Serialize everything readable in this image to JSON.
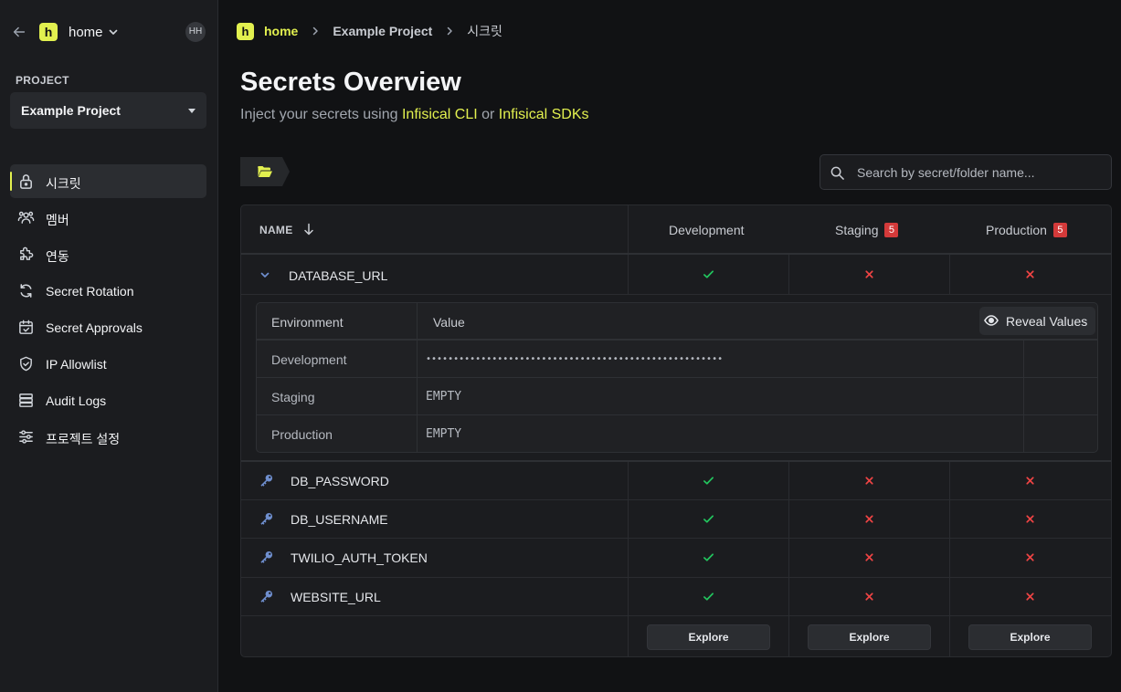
{
  "sidebar": {
    "org_logo_letter": "h",
    "org_name": "home",
    "avatar_initials": "HH",
    "project_label": "PROJECT",
    "project_selected": "Example Project",
    "nav": [
      {
        "label": "시크릿",
        "icon": "lock-icon",
        "active": true
      },
      {
        "label": "멤버",
        "icon": "users-icon",
        "active": false
      },
      {
        "label": "연동",
        "icon": "puzzle-icon",
        "active": false
      },
      {
        "label": "Secret Rotation",
        "icon": "rotate-icon",
        "active": false
      },
      {
        "label": "Secret Approvals",
        "icon": "approval-icon",
        "active": false
      },
      {
        "label": "IP Allowlist",
        "icon": "shield-icon",
        "active": false
      },
      {
        "label": "Audit Logs",
        "icon": "logs-icon",
        "active": false
      },
      {
        "label": "프로젝트 설정",
        "icon": "sliders-icon",
        "active": false
      }
    ]
  },
  "breadcrumb": {
    "logo_letter": "h",
    "home": "home",
    "sep": ">",
    "project": "Example Project",
    "current": "시크릿"
  },
  "header": {
    "title": "Secrets Overview",
    "subtitle_pre": "Inject your secrets using ",
    "link_cli": "Infisical CLI",
    "subtitle_mid": " or ",
    "link_sdks": "Infisical SDKs"
  },
  "search": {
    "placeholder": "Search by secret/folder name..."
  },
  "table": {
    "name_header": "NAME",
    "environments": [
      {
        "name": "Development",
        "badge": ""
      },
      {
        "name": "Staging",
        "badge": "5"
      },
      {
        "name": "Production",
        "badge": "5"
      }
    ],
    "rows": [
      {
        "name": "DATABASE_URL",
        "expanded": true,
        "status": [
          "present",
          "missing",
          "missing"
        ]
      },
      {
        "name": "DB_PASSWORD",
        "expanded": false,
        "status": [
          "present",
          "missing",
          "missing"
        ]
      },
      {
        "name": "DB_USERNAME",
        "expanded": false,
        "status": [
          "present",
          "missing",
          "missing"
        ]
      },
      {
        "name": "TWILIO_AUTH_TOKEN",
        "expanded": false,
        "status": [
          "present",
          "missing",
          "missing"
        ]
      },
      {
        "name": "WEBSITE_URL",
        "expanded": false,
        "status": [
          "present",
          "missing",
          "missing"
        ]
      }
    ],
    "expanded_detail": {
      "col_env": "Environment",
      "col_value": "Value",
      "reveal_label": "Reveal Values",
      "rows": [
        {
          "env": "Development",
          "value": "••••••••••••••••••••••••••••••••••••••••••••••••••••••"
        },
        {
          "env": "Staging",
          "value": "EMPTY"
        },
        {
          "env": "Production",
          "value": "EMPTY"
        }
      ]
    },
    "explore_label": "Explore"
  },
  "colors": {
    "accent": "#e2f04f",
    "present": "#22c55e",
    "missing": "#ef4444",
    "badge": "#d43a3a"
  }
}
